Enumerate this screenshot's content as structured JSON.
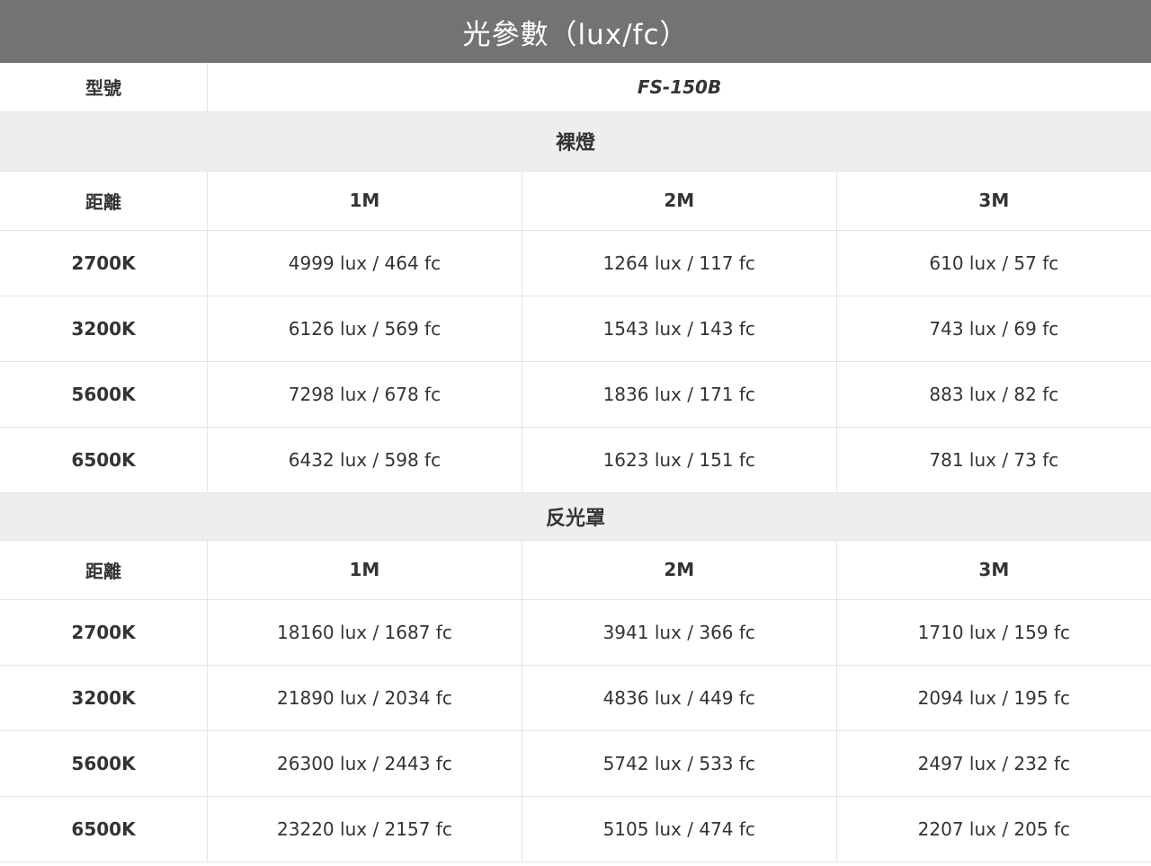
{
  "title": "光參數（lux/fc）",
  "model_label": "型號",
  "model_value": "FS-150B",
  "sections": [
    {
      "name": "裸燈",
      "distance_label": "距離",
      "columns": [
        "1M",
        "2M",
        "3M"
      ],
      "rows": [
        {
          "temp": "2700K",
          "values": [
            "4999 lux / 464 fc",
            "1264 lux / 117 fc",
            "610 lux / 57 fc"
          ]
        },
        {
          "temp": "3200K",
          "values": [
            "6126 lux / 569 fc",
            "1543 lux / 143 fc",
            "743 lux / 69 fc"
          ]
        },
        {
          "temp": "5600K",
          "values": [
            "7298 lux / 678 fc",
            "1836 lux / 171 fc",
            "883 lux / 82 fc"
          ]
        },
        {
          "temp": "6500K",
          "values": [
            "6432 lux / 598 fc",
            "1623 lux / 151 fc",
            "781 lux / 73 fc"
          ]
        }
      ]
    },
    {
      "name": "反光罩",
      "distance_label": "距離",
      "columns": [
        "1M",
        "2M",
        "3M"
      ],
      "rows": [
        {
          "temp": "2700K",
          "values": [
            "18160 lux / 1687 fc",
            "3941 lux / 366 fc",
            "1710 lux / 159 fc"
          ]
        },
        {
          "temp": "3200K",
          "values": [
            "21890 lux / 2034 fc",
            "4836 lux / 449 fc",
            "2094 lux / 195 fc"
          ]
        },
        {
          "temp": "5600K",
          "values": [
            "26300 lux / 2443 fc",
            "5742 lux / 533 fc",
            "2497 lux / 232 fc"
          ]
        },
        {
          "temp": "6500K",
          "values": [
            "23220 lux / 2157 fc",
            "5105 lux / 474 fc",
            "2207 lux / 205 fc"
          ]
        }
      ]
    }
  ],
  "colors": {
    "title_bg": "#737373",
    "section_bg": "#eeeeee",
    "border": "#e4e4e4",
    "text": "#333333"
  }
}
